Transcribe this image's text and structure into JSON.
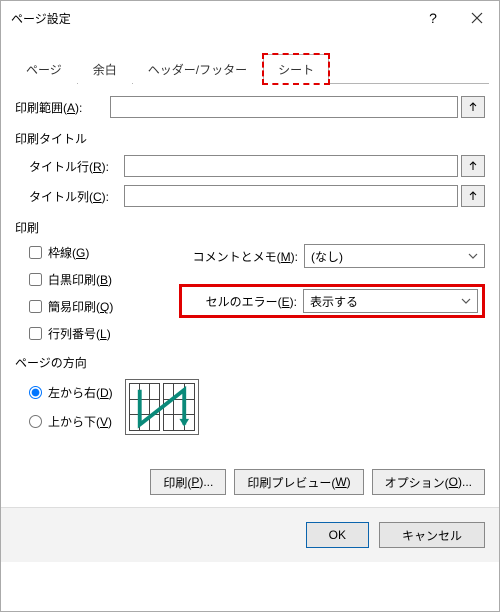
{
  "titlebar": {
    "title": "ページ設定"
  },
  "tabs": {
    "page": "ページ",
    "margins": "余白",
    "headerfooter": "ヘッダー/フッター",
    "sheet": "シート"
  },
  "print_area": {
    "label": "印刷範囲(",
    "key": "A",
    "suffix": "):"
  },
  "print_titles": {
    "title": "印刷タイトル",
    "row": {
      "label": "タイトル行(",
      "key": "R",
      "suffix": "):"
    },
    "col": {
      "label": "タイトル列(",
      "key": "C",
      "suffix": "):"
    }
  },
  "print_section": {
    "title": "印刷",
    "gridlines": {
      "label": "枠線(",
      "key": "G",
      "suffix": ")"
    },
    "bw": {
      "label": "白黒印刷(",
      "key": "B",
      "suffix": ")"
    },
    "draft": {
      "label": "簡易印刷(",
      "key": "Q",
      "suffix": ")"
    },
    "headings": {
      "label": "行列番号(",
      "key": "L",
      "suffix": ")"
    },
    "comments": {
      "label": "コメントとメモ(",
      "key": "M",
      "suffix": "):",
      "value": "(なし)"
    },
    "errors": {
      "label": "セルのエラー(",
      "key": "E",
      "suffix": "):",
      "value": "表示する"
    }
  },
  "page_order": {
    "title": "ページの方向",
    "ltr": {
      "label": "左から右(",
      "key": "D",
      "suffix": ")"
    },
    "ttb": {
      "label": "上から下(",
      "key": "V",
      "suffix": ")"
    }
  },
  "buttons": {
    "print": {
      "label": "印刷(",
      "key": "P",
      "suffix": ")..."
    },
    "preview": {
      "label": "印刷プレビュー(",
      "key": "W",
      "suffix": ")"
    },
    "options": {
      "label": "オプション(",
      "key": "O",
      "suffix": ")..."
    },
    "ok": "OK",
    "cancel": "キャンセル"
  }
}
